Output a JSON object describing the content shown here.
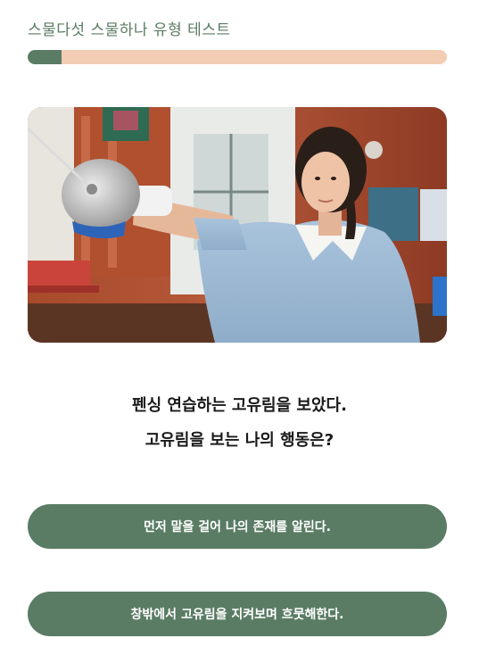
{
  "header": {
    "title": "스물다섯 스물하나 유형 테스트"
  },
  "progress": {
    "fraction": 0.08,
    "track_color": "#f2cdb3",
    "fill_color": "#5a7c64"
  },
  "question": {
    "line1": "펜싱 연습하는 고유림을 보았다.",
    "line2": "고유림을 보는 나의 행동은?"
  },
  "answers": [
    {
      "label": "먼저 말을 걸어 나의 존재를 알린다."
    },
    {
      "label": "창밖에서 고유림을 지켜보며 흐뭇해한다."
    }
  ],
  "colors": {
    "accent": "#5a7c64",
    "title_text": "#5b7b63"
  }
}
